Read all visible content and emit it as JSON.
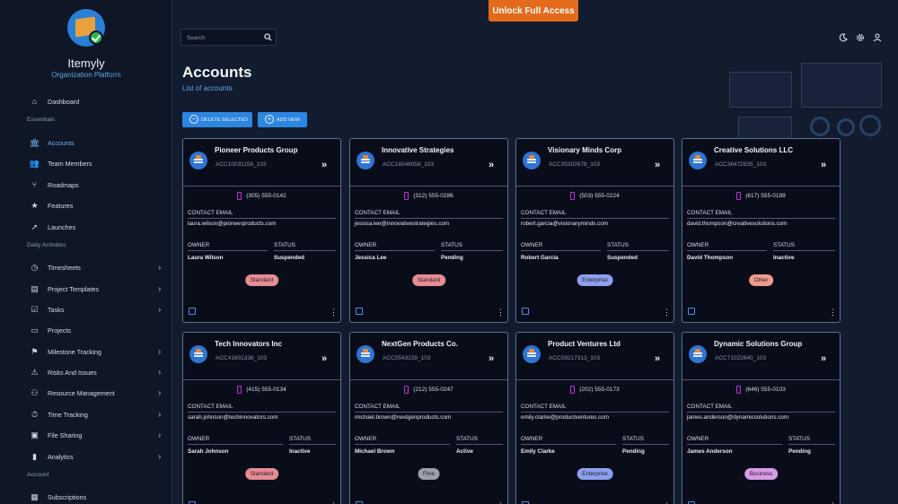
{
  "app": {
    "name": "Itemyly",
    "subtitle": "Organization Platform"
  },
  "top": {
    "unlock_label": "Unlock Full Access",
    "search_placeholder": "Search"
  },
  "page": {
    "title": "Accounts",
    "subtitle": "List of accounts"
  },
  "actions": {
    "delete_label": "DELETE SELECTED",
    "add_label": "ADD NEW"
  },
  "sidebar": {
    "items": [
      {
        "label": "Dashboard",
        "icon": "home-icon"
      },
      {
        "section": "Essentials"
      },
      {
        "label": "Accounts",
        "icon": "bank-icon",
        "active": true
      },
      {
        "label": "Team Members",
        "icon": "team-icon"
      },
      {
        "label": "Roadmaps",
        "icon": "roadmap-icon"
      },
      {
        "label": "Features",
        "icon": "star-icon"
      },
      {
        "label": "Launches",
        "icon": "rocket-icon"
      },
      {
        "section": "Daily Activities"
      },
      {
        "label": "Timesheets",
        "icon": "clock-icon",
        "chevron": true
      },
      {
        "label": "Project Templates",
        "icon": "template-icon",
        "chevron": true
      },
      {
        "label": "Tasks",
        "icon": "checkbox-icon",
        "chevron": true
      },
      {
        "label": "Projects",
        "icon": "folder-icon"
      },
      {
        "label": "Milestone Tracking",
        "icon": "flag-icon",
        "chevron": true
      },
      {
        "label": "Risks And Issues",
        "icon": "warning-icon",
        "chevron": true
      },
      {
        "label": "Resource Management",
        "icon": "people-icon",
        "chevron": true
      },
      {
        "label": "Time Tracking",
        "icon": "stopwatch-icon",
        "chevron": true
      },
      {
        "label": "File Sharing",
        "icon": "folder-share-icon",
        "chevron": true
      },
      {
        "label": "Analytics",
        "icon": "chart-icon",
        "chevron": true
      },
      {
        "section": "Account"
      },
      {
        "label": "Subscriptions",
        "icon": "subscription-icon"
      }
    ]
  },
  "labels": {
    "contact_email": "CONTACT EMAIL",
    "owner": "OWNER",
    "status": "STATUS"
  },
  "colors": {
    "Standard": "#e88c94",
    "Enterprise": "#8e9ff0",
    "Other": "#f29a8e",
    "Free": "#9aa0aa",
    "Business": "#d89be6"
  },
  "cards": [
    {
      "name": "Pioneer Products Group",
      "id": "ACC10031156_103",
      "phone": "(305) 555-0142",
      "email": "laura.wilson@pioneerproducts.com",
      "owner": "Laura Wilson",
      "status": "Suspended",
      "plan": "Standard"
    },
    {
      "name": "Innovative Strategies",
      "id": "ACC16546058_103",
      "phone": "(312) 555-0286",
      "email": "jessica.lee@innovativestrategies.com",
      "owner": "Jessica Lee",
      "status": "Pending",
      "plan": "Standard"
    },
    {
      "name": "Visionary Minds Corp",
      "id": "ACC35302678_103",
      "phone": "(503) 555-0224",
      "email": "robert.garcia@visionaryminds.com",
      "owner": "Robert Garcia",
      "status": "Suspended",
      "plan": "Enterprise"
    },
    {
      "name": "Creative Solutions LLC",
      "id": "ACC36472835_103",
      "phone": "(617) 555-0199",
      "email": "david.thompson@creativesolutions.com",
      "owner": "David Thompson",
      "status": "Inactive",
      "plan": "Other"
    },
    {
      "name": "Tech Innovators Inc",
      "id": "ACC41601338_103",
      "phone": "(415) 555-0134",
      "email": "sarah.johnson@techinnovators.com",
      "owner": "Sarah Johnson",
      "status": "Inactive",
      "plan": "Standard"
    },
    {
      "name": "NextGen Products Co.",
      "id": "ACC5543239_103",
      "phone": "(212) 555-0247",
      "email": "michael.brown@nextgenproducts.com",
      "owner": "Michael Brown",
      "status": "Active",
      "plan": "Free"
    },
    {
      "name": "Product Ventures Ltd",
      "id": "ACC59217313_103",
      "phone": "(202) 555-0173",
      "email": "emily.clarke@productventures.com",
      "owner": "Emily Clarke",
      "status": "Pending",
      "plan": "Enterprise"
    },
    {
      "name": "Dynamic Solutions Group",
      "id": "ACC71022640_103",
      "phone": "(646) 555-0103",
      "email": "james.anderson@dynamicsolutions.com",
      "owner": "James Anderson",
      "status": "Pending",
      "plan": "Business"
    }
  ]
}
